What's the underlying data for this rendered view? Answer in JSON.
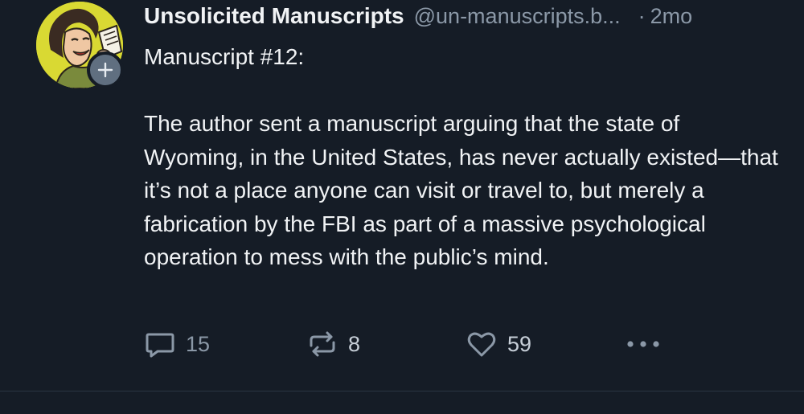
{
  "post": {
    "author": {
      "display_name": "Unsolicited Manuscripts",
      "handle": "@un-manuscripts.b...",
      "avatar_icon": "retro-woman-avatar-icon",
      "follow_icon": "plus-icon"
    },
    "separator": "·",
    "timestamp": "2mo",
    "text": "Manuscript #12:\n\nThe author sent a manuscript arguing that the state of Wyoming, in the United States, has never actually existed—that it’s not a place anyone can visit or travel to, but merely a fabrication by the FBI as part of a massive psychological operation to mess with the public’s mind.",
    "actions": {
      "reply": {
        "icon": "reply-icon",
        "count": "15"
      },
      "repost": {
        "icon": "repost-icon",
        "count": "8"
      },
      "like": {
        "icon": "heart-icon",
        "count": "59"
      },
      "more": {
        "icon": "more-options-icon"
      }
    }
  },
  "colors": {
    "background": "#151c26",
    "text_primary": "#f1f3f5",
    "text_secondary": "#8b98a7",
    "avatar_bg": "#d9d933",
    "badge_bg": "#606f80"
  }
}
